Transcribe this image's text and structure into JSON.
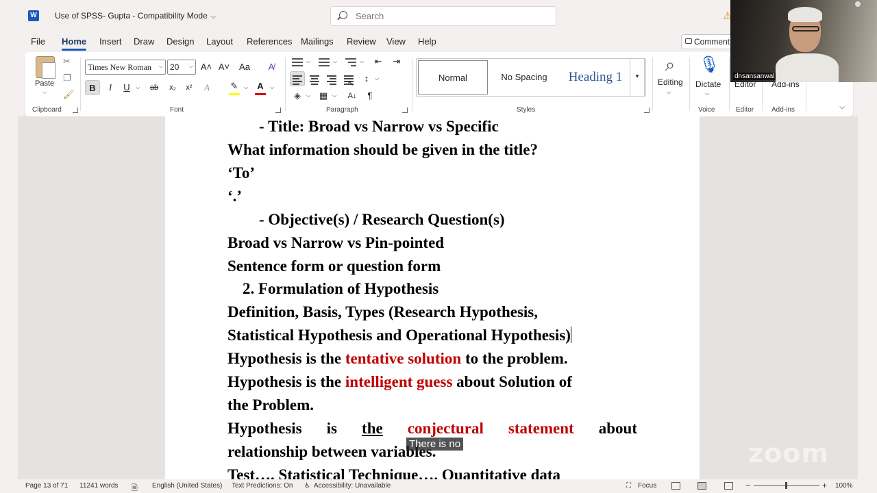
{
  "app": {
    "logo_letter": "W",
    "doc_title": "Use of SPSS- Gupta  -  Compatibility Mode",
    "search_placeholder": "Search",
    "comments_label": "Comment"
  },
  "menu": {
    "tabs": [
      "File",
      "Home",
      "Insert",
      "Draw",
      "Design",
      "Layout",
      "References",
      "Mailings",
      "Review",
      "View",
      "Help"
    ],
    "active": "Home"
  },
  "ribbon": {
    "clipboard": {
      "paste_label": "Paste",
      "group_label": "Clipboard"
    },
    "font": {
      "font_name": "Times New Roman",
      "font_size": "20",
      "grow": "A˄",
      "shrink": "A˅",
      "change_case": "Aa",
      "bold": "B",
      "italic": "I",
      "underline": "U",
      "strike": "ab",
      "subscript": "x₂",
      "superscript": "x²",
      "group_label": "Font",
      "highlight_color": "#ffff00",
      "font_color": "#e00000"
    },
    "paragraph": {
      "group_label": "Paragraph",
      "pilcrow": "¶"
    },
    "styles": {
      "items": [
        "Normal",
        "No Spacing",
        "Heading 1"
      ],
      "selected": "Normal",
      "group_label": "Styles"
    },
    "editing": {
      "label": "Editing"
    },
    "voice": {
      "button_label": "Dictate",
      "group_label": "Voice"
    },
    "editor": {
      "button_label": "Editor",
      "group_label": "Editor"
    },
    "addins": {
      "button_label": "Add-ins",
      "group_label": "Add-ins"
    }
  },
  "document": {
    "line1": "-   Title: Broad vs Narrow vs Specific",
    "line2": "What information should be given in the title?",
    "line3": "‘To’",
    "line4": "‘.’",
    "line5": "-   Objective(s) / Research Question(s)",
    "line6": "Broad vs Narrow vs Pin-pointed",
    "line7": "Sentence form or question form",
    "line8_num": "2.",
    "line8": "Formulation of Hypothesis",
    "line9": "Definition, Basis, Types (Research Hypothesis,",
    "line10": "Statistical Hypothesis and Operational Hypothesis)",
    "line11_a": "Hypothesis is the ",
    "line11_red": "tentative solution",
    "line11_b": " to the problem.",
    "line12_a": "Hypothesis is the ",
    "line12_red": "intelligent guess",
    "line12_b": " about Solution of",
    "line13": "the Problem.",
    "line14_words": [
      "Hypothesis",
      "is",
      "the"
    ],
    "line14_red": [
      "conjectural",
      "statement"
    ],
    "line14_end": "about",
    "line15": "relationship between variables.",
    "line16": "Test…. Statistical Technique…. Quantitative data",
    "red_color": "#c00000"
  },
  "caption": "There is no",
  "status": {
    "page": "Page 13 of 71",
    "words": "11241 words",
    "language": "English (United States)",
    "predictions": "Text Predictions: On",
    "accessibility": "Accessibility: Unavailable",
    "focus": "Focus",
    "zoom_minus": "−",
    "zoom_plus": "+",
    "zoom": "100%",
    "zoom_fraction": 0.5
  },
  "video": {
    "participant": "dnsansanwal"
  },
  "watermark": "zoom"
}
